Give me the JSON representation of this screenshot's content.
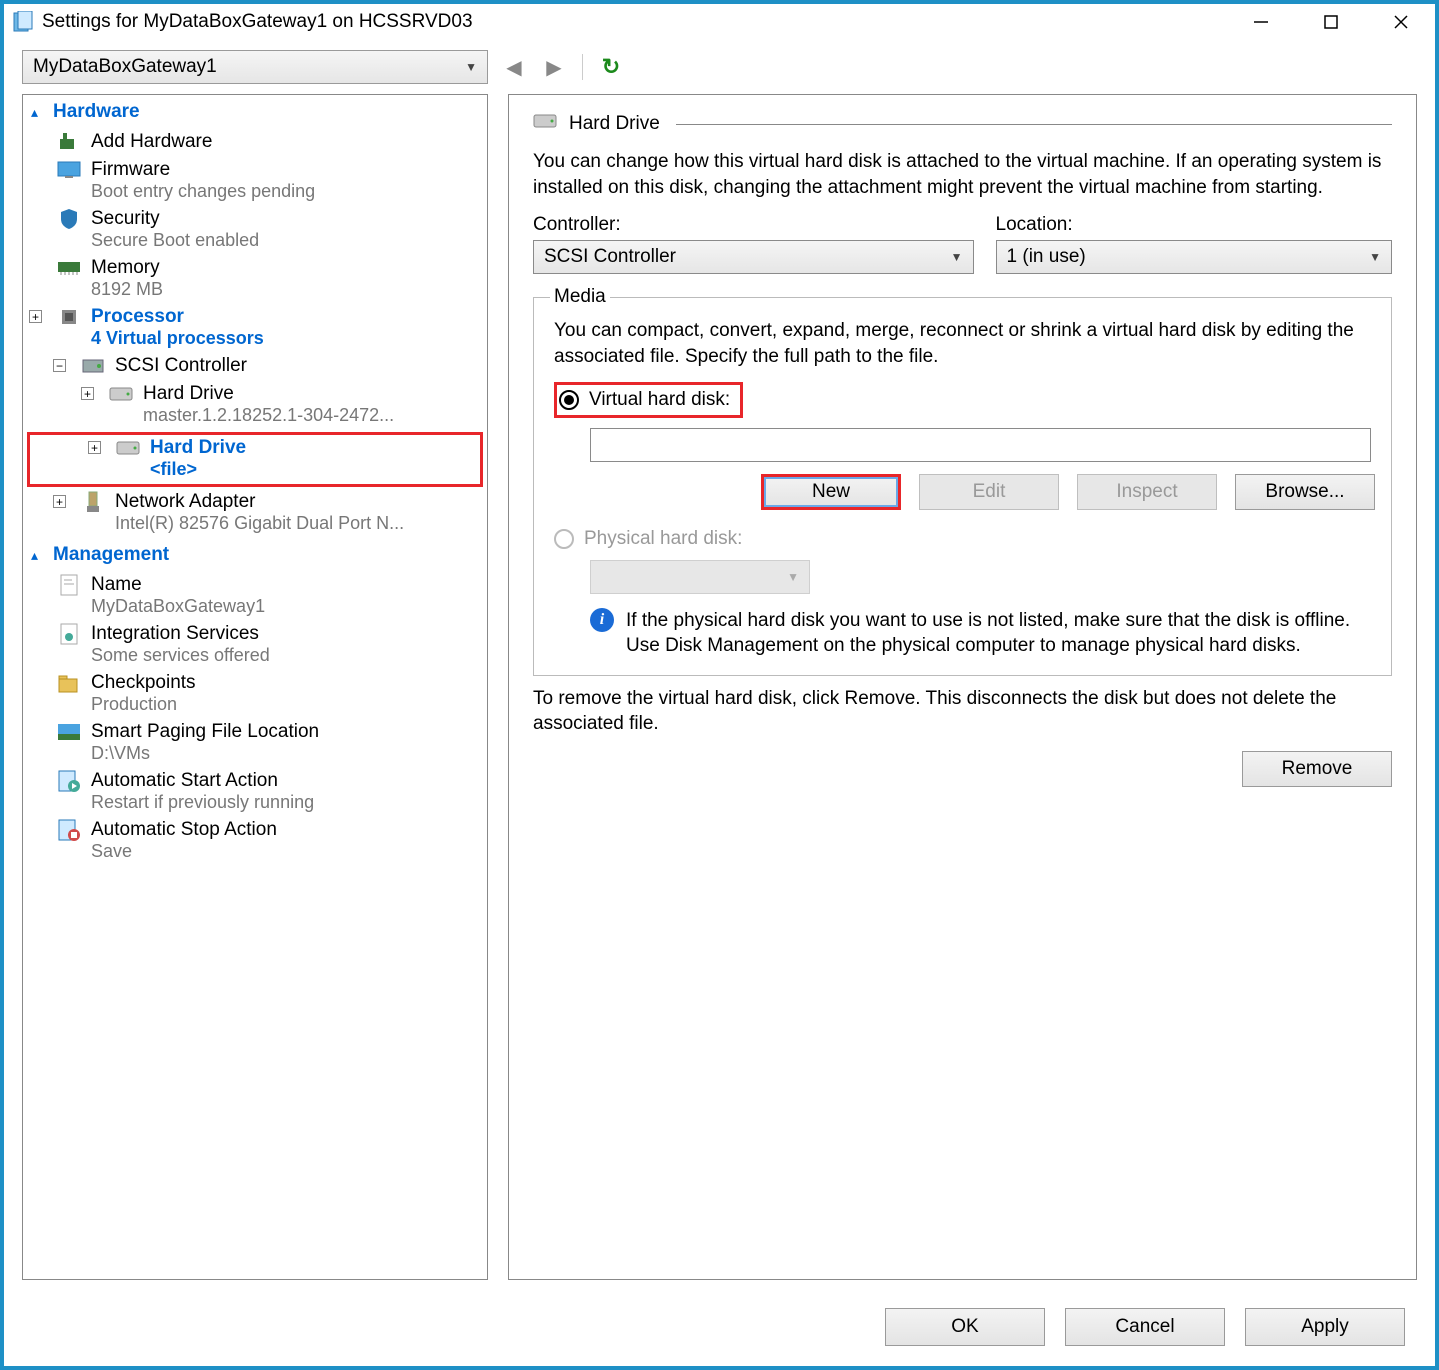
{
  "window": {
    "title": "Settings for MyDataBoxGateway1 on HCSSRVD03"
  },
  "toolbar": {
    "vm_name": "MyDataBoxGateway1"
  },
  "tree": {
    "hardware_header": "Hardware",
    "add_hardware": "Add Hardware",
    "firmware": {
      "label": "Firmware",
      "sub": "Boot entry changes pending"
    },
    "security": {
      "label": "Security",
      "sub": "Secure Boot enabled"
    },
    "memory": {
      "label": "Memory",
      "sub": "8192 MB"
    },
    "processor": {
      "label": "Processor",
      "sub": "4 Virtual processors"
    },
    "scsi": {
      "label": "SCSI Controller"
    },
    "hard_drive1": {
      "label": "Hard Drive",
      "sub": "master.1.2.18252.1-304-2472..."
    },
    "hard_drive2": {
      "label": "Hard Drive",
      "sub": "<file>"
    },
    "network": {
      "label": "Network Adapter",
      "sub": "Intel(R) 82576 Gigabit Dual Port N..."
    },
    "management_header": "Management",
    "name": {
      "label": "Name",
      "sub": "MyDataBoxGateway1"
    },
    "integration": {
      "label": "Integration Services",
      "sub": "Some services offered"
    },
    "checkpoints": {
      "label": "Checkpoints",
      "sub": "Production"
    },
    "smartpaging": {
      "label": "Smart Paging File Location",
      "sub": "D:\\VMs"
    },
    "autostart": {
      "label": "Automatic Start Action",
      "sub": "Restart if previously running"
    },
    "autostop": {
      "label": "Automatic Stop Action",
      "sub": "Save"
    }
  },
  "detail": {
    "title": "Hard Drive",
    "description": "You can change how this virtual hard disk is attached to the virtual machine. If an operating system is installed on this disk, changing the attachment might prevent the virtual machine from starting.",
    "controller_label": "Controller:",
    "controller_value": "SCSI Controller",
    "location_label": "Location:",
    "location_value": "1 (in use)",
    "media_legend": "Media",
    "media_desc": "You can compact, convert, expand, merge, reconnect or shrink a virtual hard disk by editing the associated file. Specify the full path to the file.",
    "vhd_radio": "Virtual hard disk:",
    "phd_radio": "Physical hard disk:",
    "btn_new": "New",
    "btn_edit": "Edit",
    "btn_inspect": "Inspect",
    "btn_browse": "Browse...",
    "info_text": "If the physical hard disk you want to use is not listed, make sure that the disk is offline. Use Disk Management on the physical computer to manage physical hard disks.",
    "remove_desc": "To remove the virtual hard disk, click Remove. This disconnects the disk but does not delete the associated file.",
    "btn_remove": "Remove"
  },
  "footer": {
    "ok": "OK",
    "cancel": "Cancel",
    "apply": "Apply"
  }
}
